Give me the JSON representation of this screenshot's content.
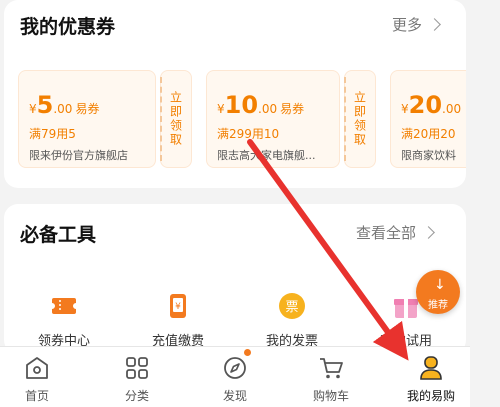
{
  "coupons_section": {
    "title": "我的优惠券",
    "more_label": "更多",
    "claim_label": "立即领取",
    "items": [
      {
        "symbol": "¥",
        "amount": "5",
        "decimal": ".00",
        "unit": "易券",
        "condition": "满79用5",
        "store": "限来伊份官方旗舰店"
      },
      {
        "symbol": "¥",
        "amount": "10",
        "decimal": ".00",
        "unit": "易券",
        "condition": "满299用10",
        "store": "限志高大家电旗舰..."
      },
      {
        "symbol": "¥",
        "amount": "20",
        "decimal": ".00",
        "unit": "",
        "condition": "满20用20",
        "store": "限商家饮料"
      }
    ]
  },
  "tools_section": {
    "title": "必备工具",
    "more_label": "查看全部",
    "items": [
      {
        "label": "领券中心",
        "icon": "ticket-icon"
      },
      {
        "label": "充值缴费",
        "icon": "phone-recharge-icon"
      },
      {
        "label": "我的发票",
        "icon": "invoice-icon"
      },
      {
        "label": "我的试用",
        "icon": "gift-icon"
      }
    ]
  },
  "floating_button": {
    "label": "推荐",
    "icon": "download-arrow-icon"
  },
  "tabbar": {
    "items": [
      {
        "label": "首页",
        "icon": "home-icon"
      },
      {
        "label": "分类",
        "icon": "category-icon"
      },
      {
        "label": "发现",
        "icon": "compass-icon"
      },
      {
        "label": "购物车",
        "icon": "cart-icon"
      },
      {
        "label": "我的易购",
        "icon": "profile-icon"
      }
    ],
    "active": "我的易购"
  },
  "colors": {
    "accent": "#f27f00",
    "annotation_arrow": "#e8322e"
  }
}
